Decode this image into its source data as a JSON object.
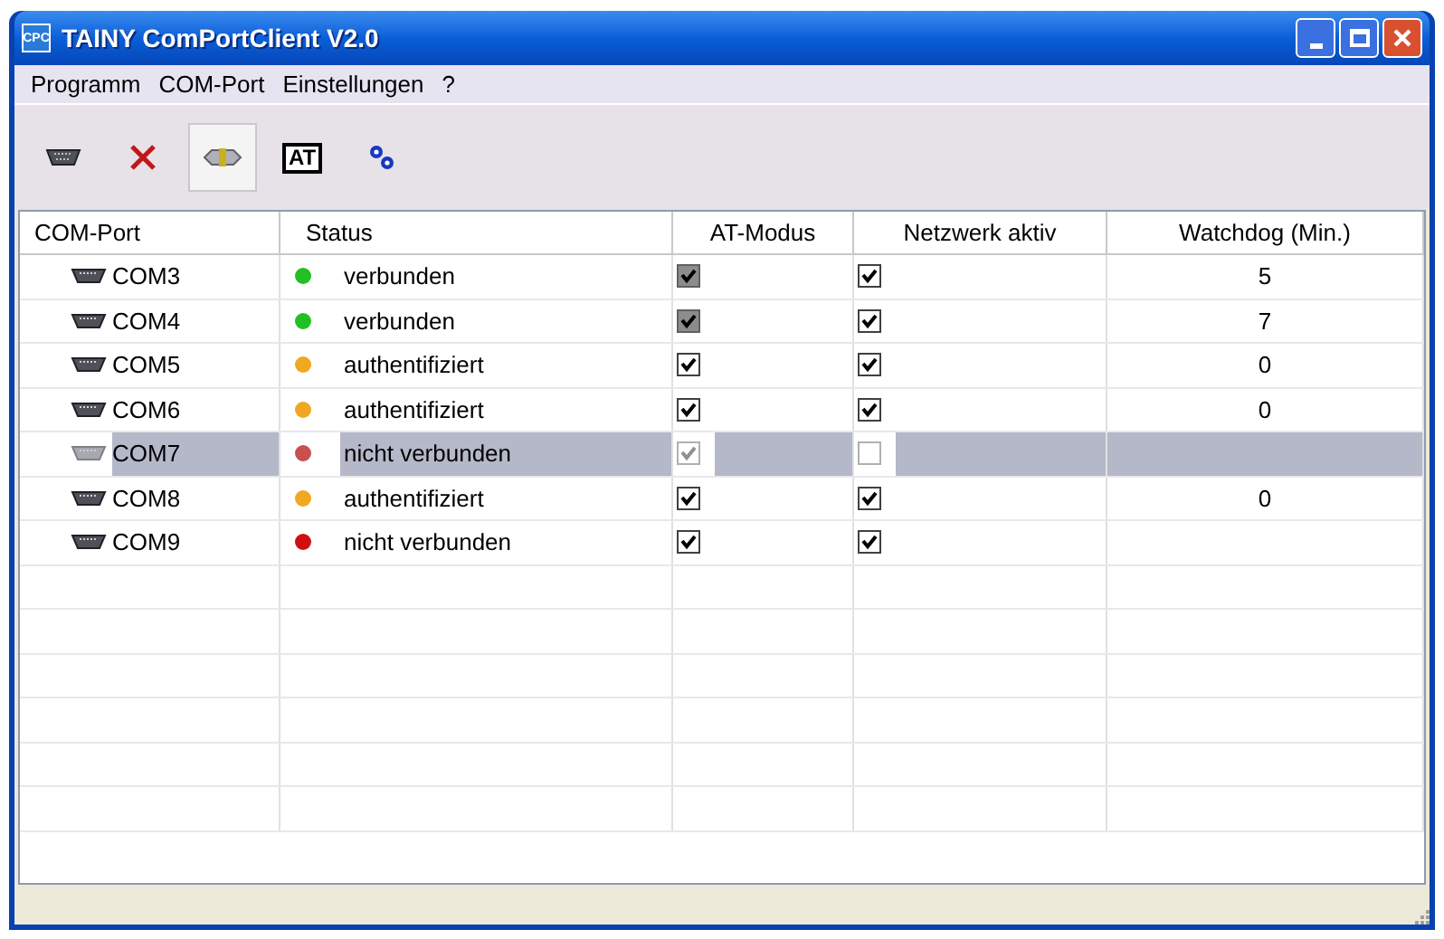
{
  "window": {
    "title": "TAINY ComPortClient V2.0",
    "app_icon": "CPC"
  },
  "menu": [
    "Programm",
    "COM-Port",
    "Einstellungen",
    "?"
  ],
  "toolbar": [
    {
      "kind": "port",
      "pressed": false
    },
    {
      "kind": "delete",
      "pressed": false
    },
    {
      "kind": "connect",
      "pressed": true
    },
    {
      "kind": "at",
      "label": "AT",
      "pressed": false
    },
    {
      "kind": "settings",
      "pressed": false
    }
  ],
  "table": {
    "columns": [
      "COM-Port",
      "Status",
      "AT-Modus",
      "Netzwerk aktiv",
      "Watchdog (Min.)"
    ],
    "rows": [
      {
        "port": "COM3",
        "status": "verbunden",
        "color": "#22c022",
        "at_modus": {
          "checked": true,
          "kind": "greyed"
        },
        "netzwerk_aktiv": true,
        "watchdog": "5",
        "selected": false
      },
      {
        "port": "COM4",
        "status": "verbunden",
        "color": "#22c022",
        "at_modus": {
          "checked": true,
          "kind": "greyed"
        },
        "netzwerk_aktiv": true,
        "watchdog": "7",
        "selected": false
      },
      {
        "port": "COM5",
        "status": "authentifiziert",
        "color": "#f0a820",
        "at_modus": {
          "checked": true,
          "kind": "plain"
        },
        "netzwerk_aktiv": true,
        "watchdog": "0",
        "selected": false
      },
      {
        "port": "COM6",
        "status": "authentifiziert",
        "color": "#f0a820",
        "at_modus": {
          "checked": true,
          "kind": "plain"
        },
        "netzwerk_aktiv": true,
        "watchdog": "0",
        "selected": false
      },
      {
        "port": "COM7",
        "status": "nicht verbunden",
        "color": "#c85050",
        "at_modus": {
          "checked": true,
          "kind": "plain"
        },
        "netzwerk_aktiv": false,
        "selected": true
      },
      {
        "port": "COM8",
        "status": "authentifiziert",
        "color": "#f0a820",
        "at_modus": {
          "checked": true,
          "kind": "plain"
        },
        "netzwerk_aktiv": true,
        "watchdog": "0",
        "selected": false
      },
      {
        "port": "COM9",
        "status": "nicht verbunden",
        "color": "#d01010",
        "at_modus": {
          "checked": true,
          "kind": "plain"
        },
        "netzwerk_aktiv": true,
        "selected": false
      }
    ]
  }
}
